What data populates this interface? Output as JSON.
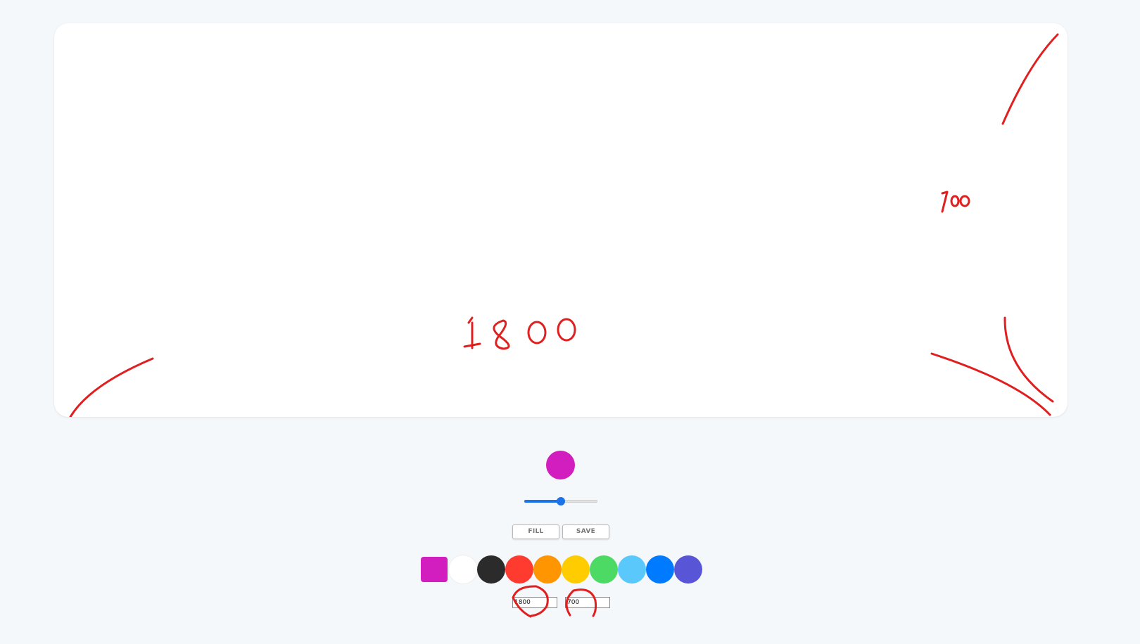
{
  "canvas": {
    "background": "#ffffff",
    "ink_color": "#e02020",
    "handwritten_annotations": [
      "1800",
      "700"
    ]
  },
  "current_color": "#d21ebf",
  "brush_size": {
    "value_percent": 50
  },
  "buttons": {
    "fill_label": "FILL",
    "save_label": "SAVE"
  },
  "palette": [
    {
      "name": "magenta",
      "color": "#d21ebf",
      "selected": true
    },
    {
      "name": "white",
      "color": "#ffffff",
      "selected": false
    },
    {
      "name": "black",
      "color": "#2b2b2b",
      "selected": false
    },
    {
      "name": "red",
      "color": "#ff3b30",
      "selected": false
    },
    {
      "name": "orange",
      "color": "#ff9500",
      "selected": false
    },
    {
      "name": "yellow",
      "color": "#ffcc00",
      "selected": false
    },
    {
      "name": "green",
      "color": "#4cd964",
      "selected": false
    },
    {
      "name": "light-blue",
      "color": "#5ac8fa",
      "selected": false
    },
    {
      "name": "blue",
      "color": "#007aff",
      "selected": false
    },
    {
      "name": "indigo",
      "color": "#5856d6",
      "selected": false
    }
  ],
  "size_inputs": {
    "width_value": "1800",
    "height_value": "700"
  }
}
